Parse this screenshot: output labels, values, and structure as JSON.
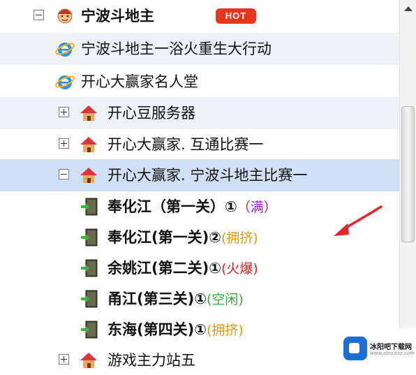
{
  "tree": {
    "root": {
      "label": "宁波斗地主",
      "badge": "HOT"
    },
    "items": [
      {
        "label": "宁波斗地主一浴火重生大行动"
      },
      {
        "label": "开心大赢家名人堂"
      },
      {
        "label": "开心豆服务器"
      },
      {
        "label": "开心大赢家. 互通比赛一"
      },
      {
        "label": "开心大赢家. 宁波斗地主比赛一"
      },
      {
        "label": "奉化江（第一关）①",
        "status": "（满）"
      },
      {
        "label": "奉化江(第一关)②",
        "status": "(拥挤)"
      },
      {
        "label": "余姚江(第二关)①",
        "status": "(火爆)"
      },
      {
        "label": "甬江(第三关)①",
        "status": "(空闲)"
      },
      {
        "label": "东海(第四关)①",
        "status": "(拥挤)"
      },
      {
        "label": "游戏主力站五"
      }
    ]
  },
  "colors": {
    "status_full": "#a020d0",
    "status_crowded": "#e09a10",
    "status_hot": "#e02020",
    "status_idle": "#3aa83a",
    "selected_row": "#cfe0f4",
    "alt_row": "#eef1f6",
    "annotation_arrow": "#e8252a"
  },
  "watermark": {
    "name": "冰阳吧下载网",
    "url": "www.aboutxz.com"
  }
}
